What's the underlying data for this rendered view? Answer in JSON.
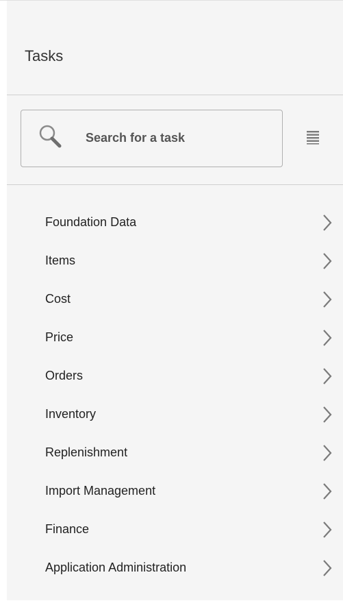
{
  "panel": {
    "title": "Tasks"
  },
  "search": {
    "placeholder": "Search for a task",
    "icon": "search-icon",
    "list_view_icon": "list-view-icon"
  },
  "tasks": [
    {
      "label": "Foundation Data",
      "icon": "chevron-right-icon"
    },
    {
      "label": "Items",
      "icon": "chevron-right-icon"
    },
    {
      "label": "Cost",
      "icon": "chevron-right-icon"
    },
    {
      "label": "Price",
      "icon": "chevron-right-icon"
    },
    {
      "label": "Orders",
      "icon": "chevron-right-icon"
    },
    {
      "label": "Inventory",
      "icon": "chevron-right-icon"
    },
    {
      "label": "Replenishment",
      "icon": "chevron-right-icon"
    },
    {
      "label": "Import Management",
      "icon": "chevron-right-icon"
    },
    {
      "label": "Finance",
      "icon": "chevron-right-icon"
    },
    {
      "label": "Application Administration",
      "icon": "chevron-right-icon"
    }
  ],
  "colors": {
    "panel_background": "#f5f5f5",
    "text": "#222222",
    "divider": "#cfcfcf",
    "icon": "#7a7a7a"
  }
}
